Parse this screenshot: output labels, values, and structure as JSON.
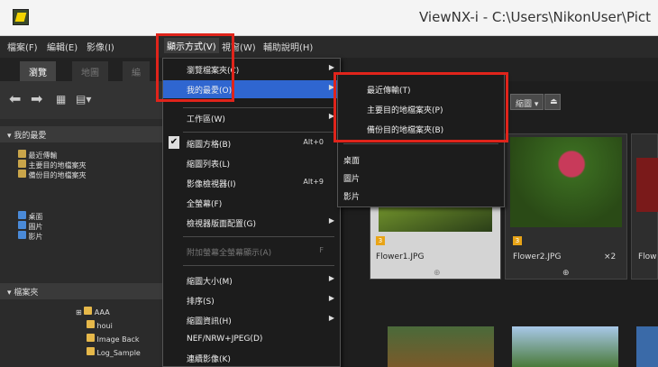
{
  "window": {
    "title": "ViewNX-i - C:\\Users\\NikonUser\\Pict"
  },
  "menubar": {
    "items": [
      "檔案(F)",
      "編輯(E)",
      "影像(I)",
      "顯示方式(V)",
      "視窗(W)",
      "輔助說明(H)"
    ]
  },
  "tabs": [
    "瀏覽",
    "地圖",
    "編"
  ],
  "left_panel": {
    "section_favorites": "我的最愛",
    "fav_items_1": [
      "最近傳輸",
      "主要目的地檔案夾",
      "備份目的地檔案夾"
    ],
    "fav_items_2": [
      "桌面",
      "圖片",
      "影片"
    ],
    "section_folders": "檔案夾",
    "folders": [
      "AAA",
      "houi",
      "Image Back",
      "Log_Sample"
    ]
  },
  "toolbar": {
    "sort_label": "縮圖 ▾"
  },
  "thumbnails": [
    {
      "label": "Flower1.JPG",
      "badge": "3"
    },
    {
      "label": "Flower2.JPG",
      "badge": "3",
      "extra": "×2"
    },
    {
      "label": "Flow"
    }
  ],
  "view_menu": {
    "items": [
      {
        "label": "瀏覽檔案夾(C)",
        "sub": true
      },
      {
        "label": "我的最愛(O)",
        "sub": true,
        "highlight": true
      },
      {
        "label": "工作區(W)",
        "sub": true
      },
      {
        "label": "縮圖方格(B)",
        "shortcut": "Alt+0",
        "checked": true
      },
      {
        "label": "縮圖列表(L)"
      },
      {
        "label": "影像檢視器(I)",
        "shortcut": "Alt+9"
      },
      {
        "label": "全螢幕(F)"
      },
      {
        "label": "檢視器版面配置(G)",
        "sub": true
      },
      {
        "label": "附加螢幕全螢幕顯示(A)",
        "shortcut": "F",
        "disabled": true
      },
      {
        "label": "縮圖大小(M)",
        "sub": true
      },
      {
        "label": "排序(S)",
        "sub": true
      },
      {
        "label": "縮圖資訊(H)",
        "sub": true
      },
      {
        "label": "NEF/NRW+JPEG(D)",
        "sub": true
      },
      {
        "label": "連續影像(K)"
      }
    ]
  },
  "favorites_submenu": {
    "items": [
      "最近傳輸(T)",
      "主要目的地檔案夾(P)",
      "備份目的地檔案夾(B)",
      "桌面",
      "圖片",
      "影片"
    ]
  }
}
